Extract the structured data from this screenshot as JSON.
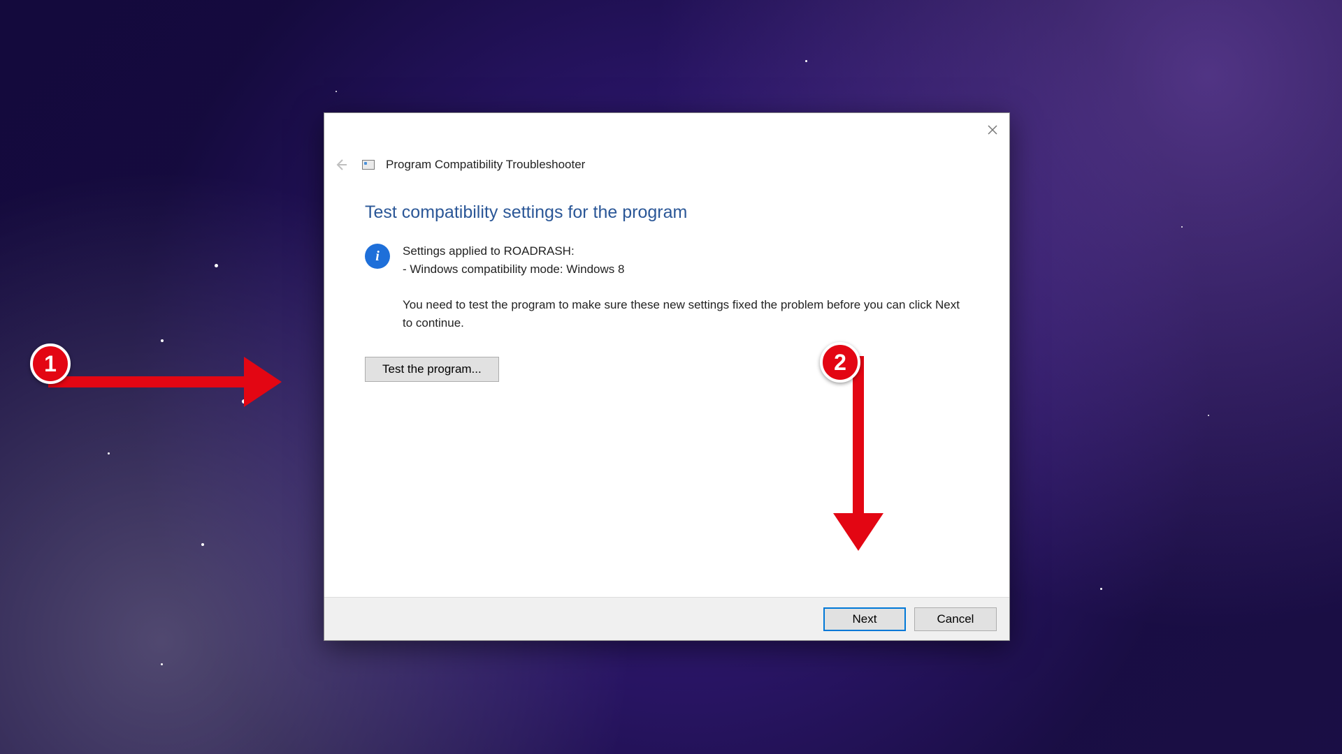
{
  "window": {
    "title": "Program Compatibility Troubleshooter",
    "heading": "Test compatibility settings for the program",
    "info_line1": "Settings applied to ROADRASH:",
    "info_line2": "- Windows compatibility mode: Windows 8",
    "instruction": "You need to test the program to make sure these new settings fixed the problem before you can click Next to continue.",
    "test_button": "Test the program...",
    "next_button": "Next",
    "cancel_button": "Cancel"
  },
  "annotations": {
    "badge1": "1",
    "badge2": "2"
  }
}
